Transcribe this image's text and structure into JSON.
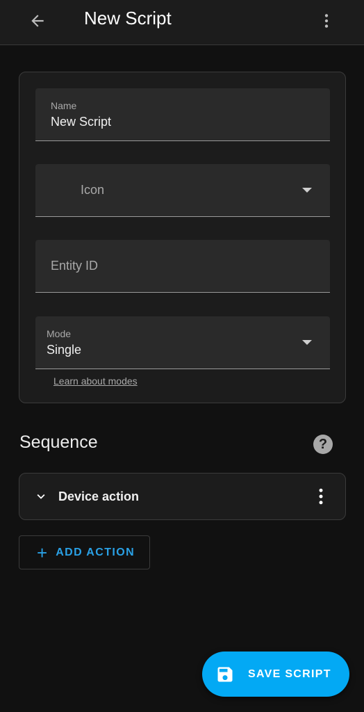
{
  "header": {
    "title": "New Script",
    "back_icon": "arrow-left-icon",
    "menu_icon": "dots-vertical-icon"
  },
  "form": {
    "name": {
      "label": "Name",
      "value": "New Script"
    },
    "icon": {
      "placeholder": "Icon"
    },
    "entity_id": {
      "placeholder": "Entity ID"
    },
    "mode": {
      "label": "Mode",
      "value": "Single"
    },
    "learn_link": "Learn about modes"
  },
  "sequence": {
    "title": "Sequence",
    "actions": [
      {
        "label": "Device action"
      }
    ],
    "add_label": "ADD ACTION"
  },
  "fab": {
    "label": "SAVE SCRIPT",
    "icon": "floppy-disk-icon"
  },
  "colors": {
    "accent": "#03a9f4",
    "link_accent": "#2aa1e6",
    "background": "#111111",
    "card": "#1c1c1c",
    "field": "#2a2a2a"
  }
}
